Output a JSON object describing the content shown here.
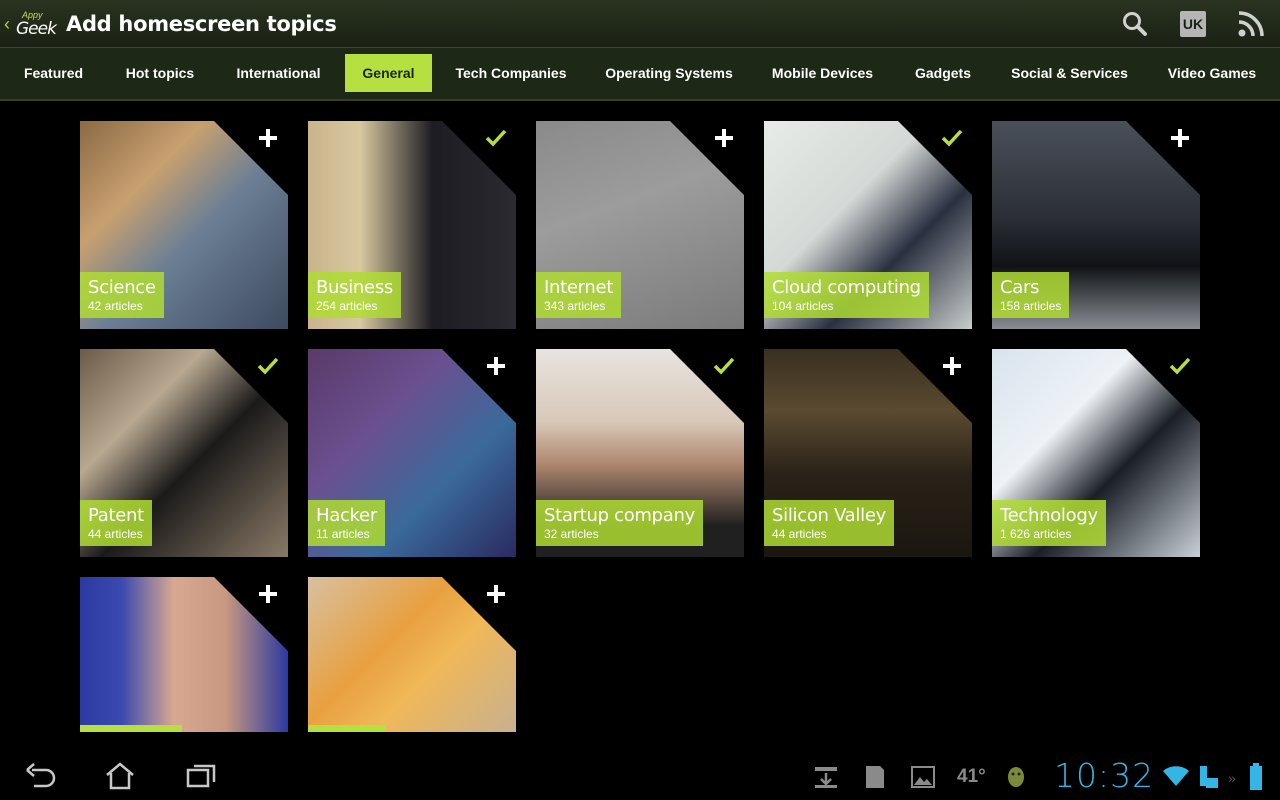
{
  "app": {
    "logo_top": "Appy",
    "logo_main": "Geek",
    "title": "Add homescreen topics",
    "region_badge": "UK"
  },
  "tabs": [
    {
      "label": "Featured",
      "active": false
    },
    {
      "label": "Hot topics",
      "active": false
    },
    {
      "label": "International",
      "active": false
    },
    {
      "label": "General",
      "active": true
    },
    {
      "label": "Tech Companies",
      "active": false
    },
    {
      "label": "Operating Systems",
      "active": false
    },
    {
      "label": "Mobile Devices",
      "active": false
    },
    {
      "label": "Gadgets",
      "active": false
    },
    {
      "label": "Social & Services",
      "active": false
    },
    {
      "label": "Video Games",
      "active": false
    }
  ],
  "topics": [
    {
      "name": "Science",
      "count": "42 articles",
      "state": "add",
      "icon": "plus-icon"
    },
    {
      "name": "Business",
      "count": "254 articles",
      "state": "added",
      "icon": "check-icon"
    },
    {
      "name": "Internet",
      "count": "343 articles",
      "state": "add",
      "icon": "plus-icon"
    },
    {
      "name": "Cloud computing",
      "count": "104 articles",
      "state": "added",
      "icon": "check-icon"
    },
    {
      "name": "Cars",
      "count": "158 articles",
      "state": "add",
      "icon": "plus-icon"
    },
    {
      "name": "Patent",
      "count": "44 articles",
      "state": "added",
      "icon": "check-icon"
    },
    {
      "name": "Hacker",
      "count": "11 articles",
      "state": "add",
      "icon": "plus-icon"
    },
    {
      "name": "Startup company",
      "count": "32 articles",
      "state": "added",
      "icon": "check-icon"
    },
    {
      "name": "Silicon Valley",
      "count": "44 articles",
      "state": "add",
      "icon": "plus-icon"
    },
    {
      "name": "Technology",
      "count": "1 626 articles",
      "state": "added",
      "icon": "check-icon"
    },
    {
      "name": "",
      "count": "",
      "state": "add",
      "icon": "plus-icon"
    },
    {
      "name": "",
      "count": "",
      "state": "add",
      "icon": "plus-icon"
    }
  ],
  "status": {
    "temperature": "41°",
    "clock": "10:32"
  },
  "colors": {
    "accent": "#b6e03f",
    "clock": "#33b5e5",
    "actionbar": "#1e2816"
  }
}
